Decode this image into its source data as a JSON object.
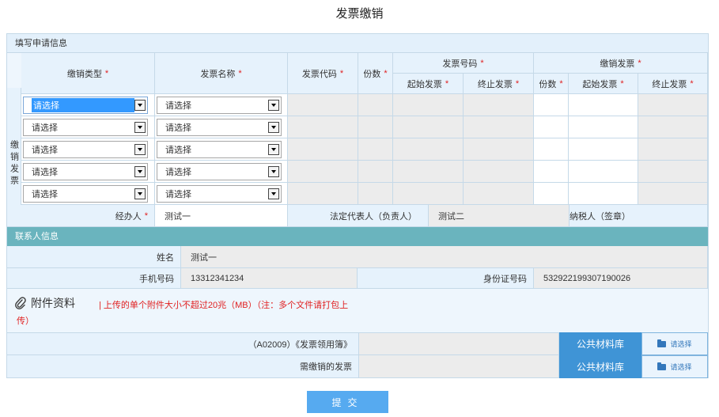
{
  "page_title": "发票缴销",
  "section_apply": "填写申请信息",
  "side_label": "缴销发票",
  "headers": {
    "type": "缴销类型",
    "invoice_name": "发票名称",
    "invoice_code": "发票代码",
    "copies": "份数",
    "invoice_number": "发票号码",
    "start_invoice": "起始发票",
    "end_invoice": "终止发票",
    "cancel_invoice": "缴销发票",
    "cancel_copies": "份数",
    "cancel_start": "起始发票",
    "cancel_end": "终止发票",
    "required_mark": "*"
  },
  "rows": [
    {
      "type": "请选择",
      "invoice_name": "请选择"
    },
    {
      "type": "请选择",
      "invoice_name": "请选择"
    },
    {
      "type": "请选择",
      "invoice_name": "请选择"
    },
    {
      "type": "请选择",
      "invoice_name": "请选择"
    },
    {
      "type": "请选择",
      "invoice_name": "请选择"
    }
  ],
  "signers": {
    "handler_label": "经办人",
    "handler_value": "测试一",
    "legal_label": "法定代表人（负责人）",
    "legal_value": "测试二",
    "taxpayer_label": "纳税人（签章）"
  },
  "contact": {
    "section_title": "联系人信息",
    "name_label": "姓名",
    "name_value": "测试一",
    "phone_label": "手机号码",
    "phone_value": "13312341234",
    "id_label": "身份证号码",
    "id_value": "532922199307190026"
  },
  "attachments": {
    "title": "附件资料",
    "note": "| 上传的单个附件大小不超过20兆（MB）（注：多个文件请打包上传）",
    "items": [
      {
        "label": "（A02009）《发票领用簿》",
        "library_button": "公共材料库",
        "choose_button": "请选择"
      },
      {
        "label": "需缴销的发票",
        "library_button": "公共材料库",
        "choose_button": "请选择"
      }
    ]
  },
  "submit_label": "提交"
}
